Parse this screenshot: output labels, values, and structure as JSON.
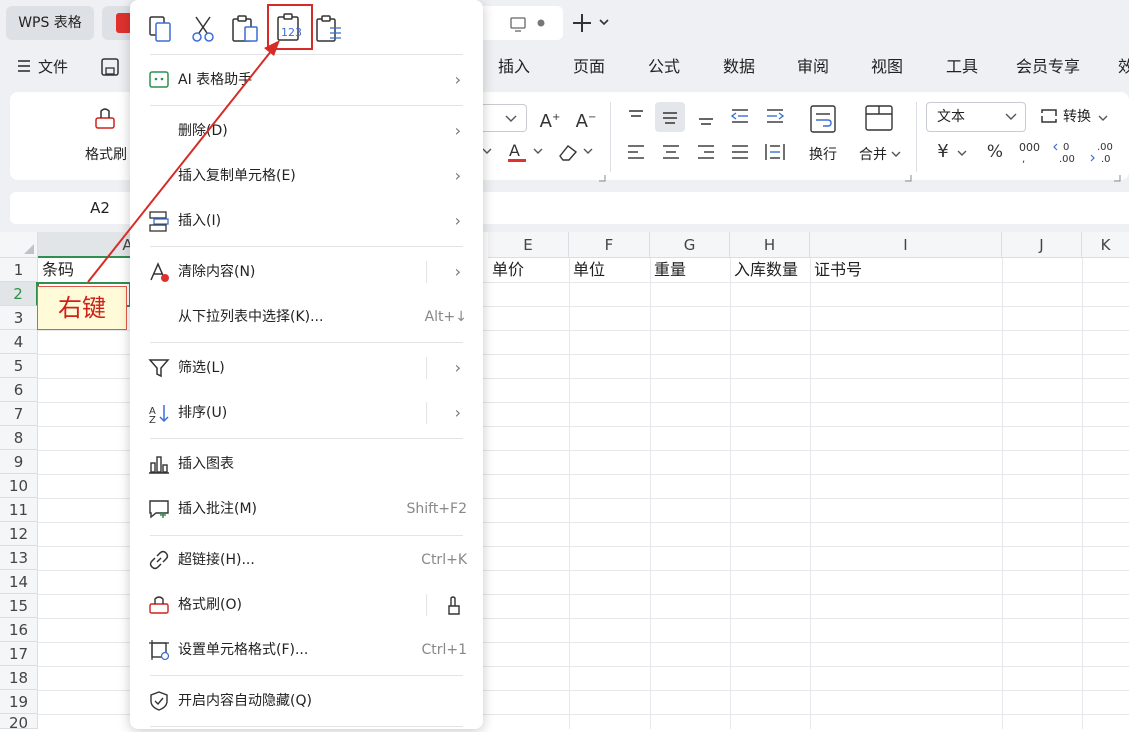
{
  "titlebar": {
    "app_tab": "WPS 表格"
  },
  "menubar": {
    "file_label": "文件",
    "items": [
      "插入",
      "页面",
      "公式",
      "数据",
      "审阅",
      "视图",
      "工具",
      "会员专享",
      "效"
    ]
  },
  "ribbon": {
    "format_painter": "格式刷",
    "number_format": "文本",
    "convert": "转换",
    "wrap": "换行",
    "merge": "合并"
  },
  "formulabar": {
    "cell_ref": "A2"
  },
  "grid": {
    "columns": [
      "A",
      "E",
      "F",
      "G",
      "H",
      "I",
      "J",
      "K"
    ],
    "rows": [
      "1",
      "2",
      "3",
      "4",
      "5",
      "6",
      "7",
      "8",
      "9",
      "10",
      "11",
      "12",
      "13",
      "14",
      "15",
      "16",
      "17",
      "18",
      "19",
      "20"
    ],
    "row1": {
      "A": "条码",
      "E": "单价",
      "F": "单位",
      "G": "重量",
      "H": "入库数量",
      "I": "证书号"
    }
  },
  "callout": {
    "text": "右键"
  },
  "context_menu": {
    "items": [
      {
        "label": "AI 表格助手",
        "shortcut": "",
        "submenu": true
      },
      {
        "label": "删除(D)",
        "shortcut": "",
        "submenu": true
      },
      {
        "label": "插入复制单元格(E)",
        "shortcut": "",
        "submenu": true
      },
      {
        "label": "插入(I)",
        "shortcut": "",
        "submenu": true
      },
      {
        "label": "清除内容(N)",
        "shortcut": "",
        "submenu": true
      },
      {
        "label": "从下拉列表中选择(K)...",
        "shortcut": "Alt+↓",
        "submenu": false
      },
      {
        "label": "筛选(L)",
        "shortcut": "",
        "submenu": true
      },
      {
        "label": "排序(U)",
        "shortcut": "",
        "submenu": true
      },
      {
        "label": "插入图表",
        "shortcut": "",
        "submenu": false
      },
      {
        "label": "插入批注(M)",
        "shortcut": "Shift+F2",
        "submenu": false
      },
      {
        "label": "超链接(H)...",
        "shortcut": "Ctrl+K",
        "submenu": false
      },
      {
        "label": "格式刷(O)",
        "shortcut": "",
        "submenu": false
      },
      {
        "label": "设置单元格格式(F)...",
        "shortcut": "Ctrl+1",
        "submenu": false
      },
      {
        "label": "开启内容自动隐藏(Q)",
        "shortcut": "",
        "submenu": false
      }
    ],
    "paste_icons": [
      "copy-icon",
      "cut-icon",
      "paste-icon",
      "paste-values-icon",
      "paste-formula-icon"
    ],
    "paste_values_digits": "123"
  },
  "colors": {
    "highlight": "#d62b26",
    "accent_red": "#e0312f",
    "grid_line": "#e6e8eb"
  }
}
